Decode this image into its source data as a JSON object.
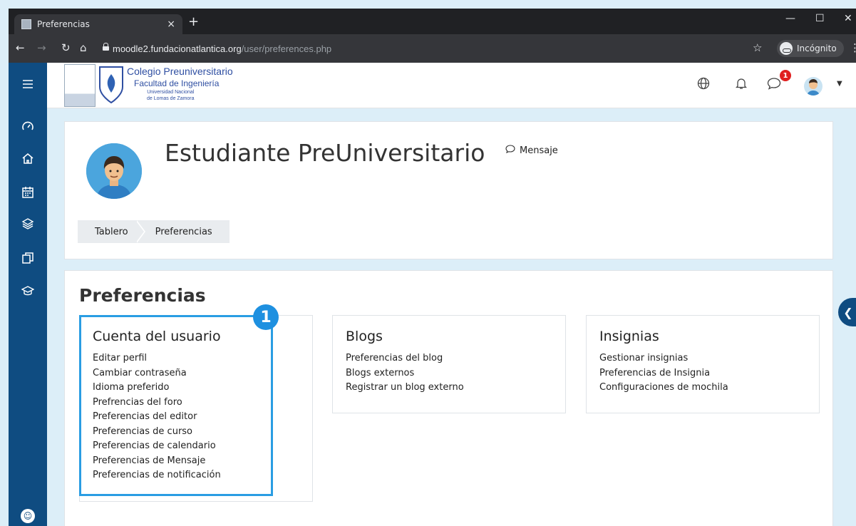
{
  "browser": {
    "tab_title": "Preferencias",
    "tab_close": "×",
    "new_tab": "+",
    "url_host": "moodle2.fundacionatlantica.org",
    "url_path": "/user/preferences.php",
    "incognito_label": "Incógnito"
  },
  "logo": {
    "line1": "Colegio Preuniversitario",
    "line2": "Facultad de Ingeniería",
    "line3": "Universidad Nacional",
    "line4": "de Lomas de Zamora"
  },
  "navbar": {
    "message_badge": "1"
  },
  "profile": {
    "name": "Estudiante PreUniversitario",
    "message_label": "Mensaje"
  },
  "breadcrumb": [
    "Tablero",
    "Preferencias"
  ],
  "page": {
    "title": "Preferencias",
    "step_number": "1"
  },
  "sections": {
    "user_account": {
      "title": "Cuenta del usuario",
      "links": [
        "Editar perfil",
        "Cambiar contraseña",
        "Idioma preferido",
        "Prefrencias del foro",
        "Preferencias del editor",
        "Preferencias de curso",
        "Preferencias de calendario",
        "Preferencias de Mensaje",
        "Preferencias de notificación"
      ]
    },
    "blogs": {
      "title": "Blogs",
      "links": [
        "Preferencias del blog",
        "Blogs externos",
        "Registrar un blog externo"
      ]
    },
    "badges": {
      "title": "Insignias",
      "links": [
        "Gestionar insignias",
        "Preferencias de Insignia",
        "Configuraciones de mochila"
      ]
    }
  },
  "icons": {
    "drawer": [
      "hamburger-icon",
      "dashboard-icon",
      "home-icon",
      "calendar-icon",
      "layers-icon",
      "files-icon",
      "graduation-cap-icon",
      "accessibility-icon"
    ],
    "navbar": [
      "globe-icon",
      "bell-icon",
      "chat-icon",
      "avatar",
      "caret-down-icon"
    ]
  },
  "colors": {
    "drawer": "#0f4c81",
    "highlight": "#2a9de3",
    "badge": "#e02020",
    "page_bg": "#dceef8"
  }
}
